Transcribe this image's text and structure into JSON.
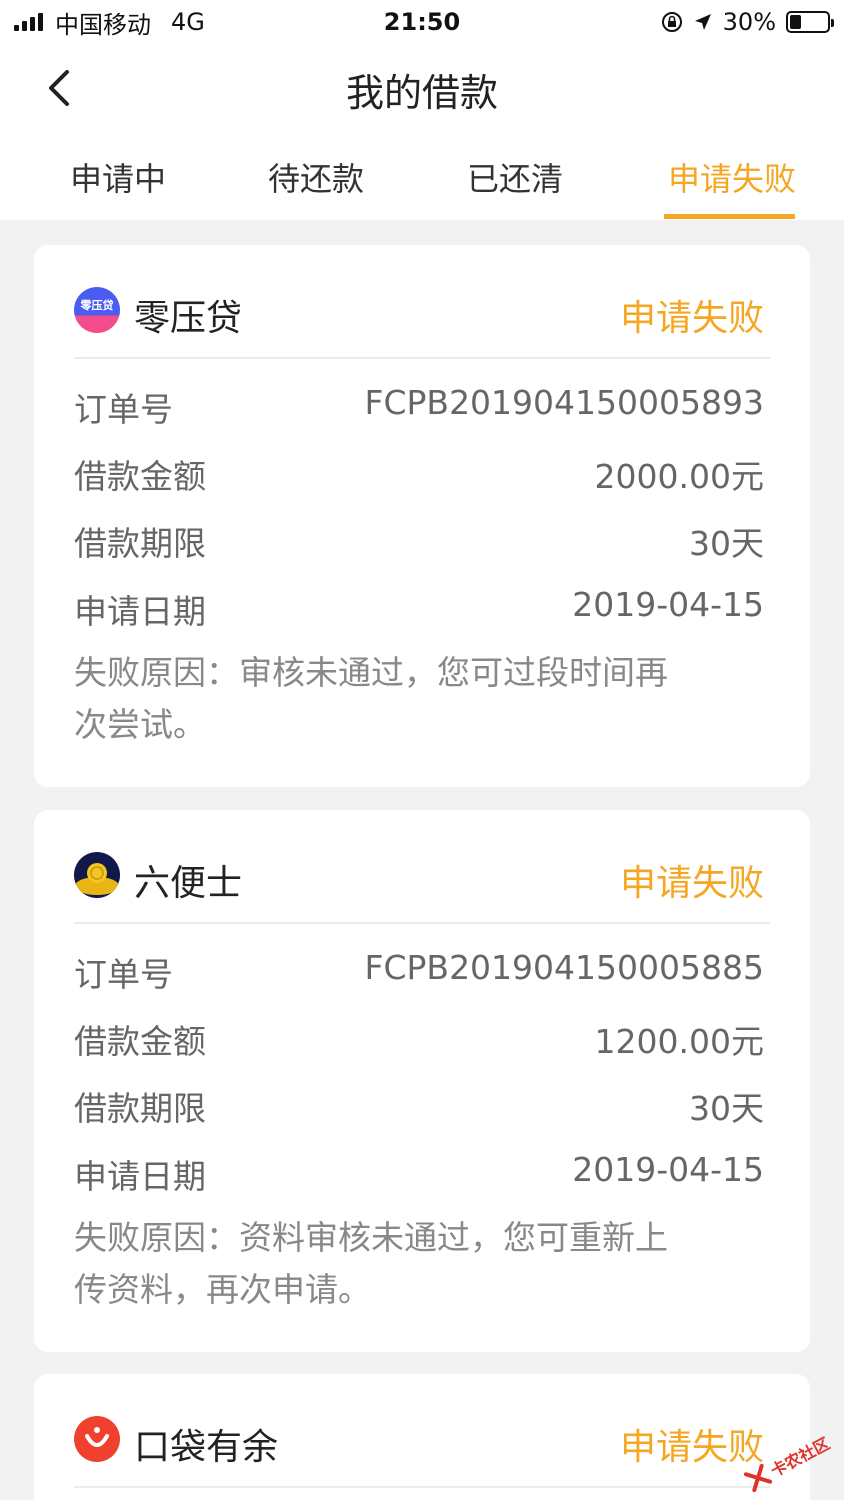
{
  "status_bar": {
    "carrier": "中国移动",
    "network": "4G",
    "time": "21:50",
    "battery": "30%",
    "battery_level": 0.3
  },
  "nav": {
    "title": "我的借款",
    "back_icon": "chevron-left-icon"
  },
  "tabs": [
    {
      "label": "申请中",
      "active": false
    },
    {
      "label": "待还款",
      "active": false
    },
    {
      "label": "已还清",
      "active": false
    },
    {
      "label": "申请失败",
      "active": true
    }
  ],
  "labels": {
    "order_no": "订单号",
    "amount": "借款金额",
    "term": "借款期限",
    "date": "申请日期"
  },
  "loans": [
    {
      "lender": "零压贷",
      "logo_text": "零压贷",
      "status": "申请失败",
      "order_no": "FCPB201904150005893",
      "amount": "2000.00元",
      "term": "30天",
      "date": "2019-04-15",
      "reason_line1": "失败原因：审核未通过，您可过段时间再",
      "reason_line2": "次尝试。"
    },
    {
      "lender": "六便士",
      "status": "申请失败",
      "order_no": "FCPB201904150005885",
      "amount": "1200.00元",
      "term": "30天",
      "date": "2019-04-15",
      "reason_line1": "失败原因：资料审核未通过，您可重新上",
      "reason_line2": "传资料，再次申请。"
    },
    {
      "lender": "口袋有余",
      "status": "申请失败"
    }
  ],
  "watermark": {
    "text": "卡农社区"
  },
  "colors": {
    "accent": "#f5a623",
    "background": "#f2f2f2",
    "card": "#ffffff"
  }
}
